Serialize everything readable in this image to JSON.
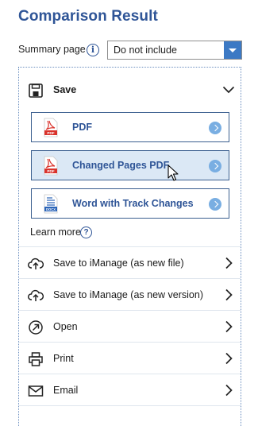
{
  "header": {
    "title": "Comparison Result"
  },
  "summary": {
    "label": "Summary page",
    "info_icon": "info-icon",
    "selected": "Do not include"
  },
  "save": {
    "label": "Save",
    "icon": "save-icon",
    "expanded": true,
    "options": [
      {
        "label": "PDF",
        "icon": "pdf-file-icon"
      },
      {
        "label": "Changed Pages PDF",
        "icon": "pdf-file-icon",
        "hovered": true
      },
      {
        "label": "Word with Track Changes",
        "icon": "docx-file-icon"
      }
    ],
    "learn_more": "Learn more",
    "help_icon_glyph": "?"
  },
  "actions": [
    {
      "label": "Save to iManage (as new file)",
      "icon": "cloud-upload-icon"
    },
    {
      "label": "Save to iManage (as new version)",
      "icon": "cloud-upload-icon"
    },
    {
      "label": "Open",
      "icon": "open-arrow-icon"
    },
    {
      "label": "Print",
      "icon": "printer-icon"
    },
    {
      "label": "Email",
      "icon": "envelope-icon"
    }
  ],
  "colors": {
    "title": "#2f5597",
    "accent": "#3c79c4",
    "hover": "#dbe8f5",
    "pdf_red": "#d9322b",
    "docx_blue": "#2b64b8"
  }
}
